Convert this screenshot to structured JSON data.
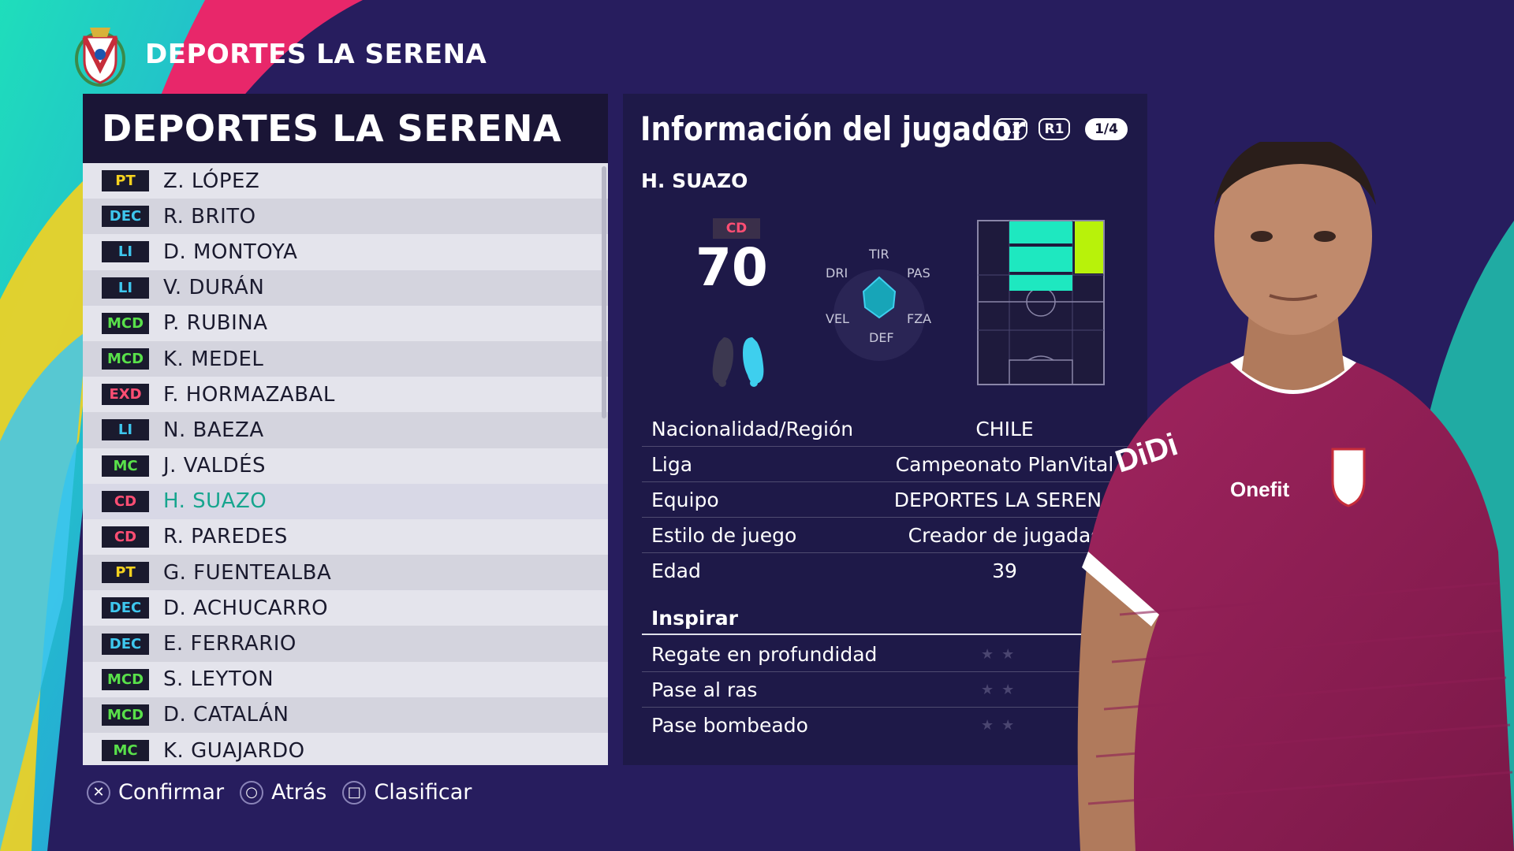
{
  "colors": {
    "background": "#271d5e",
    "selected_text": "#17a58e",
    "gk": "#f5d21f",
    "def": "#3ec7ee",
    "mid": "#59e04a",
    "fwd": "#ff4e73",
    "pitch_highlight": "#1ee8c0",
    "pitch_primary": "#b8f20a"
  },
  "header": {
    "title": "DEPORTES LA SERENA",
    "crest_icon": "club-crest-icon"
  },
  "roster": {
    "title": "DEPORTES LA SERENA",
    "players": [
      {
        "pos": "PT",
        "group": "gk",
        "name": "Z. LÓPEZ"
      },
      {
        "pos": "DEC",
        "group": "def",
        "name": "R. BRITO"
      },
      {
        "pos": "LI",
        "group": "def",
        "name": "D. MONTOYA"
      },
      {
        "pos": "LI",
        "group": "def",
        "name": "V. DURÁN"
      },
      {
        "pos": "MCD",
        "group": "mid",
        "name": "P. RUBINA"
      },
      {
        "pos": "MCD",
        "group": "mid",
        "name": "K. MEDEL"
      },
      {
        "pos": "EXD",
        "group": "fwd",
        "name": "F. HORMAZABAL"
      },
      {
        "pos": "LI",
        "group": "def",
        "name": "N. BAEZA"
      },
      {
        "pos": "MC",
        "group": "mid",
        "name": "J. VALDÉS"
      },
      {
        "pos": "CD",
        "group": "fwd",
        "name": "H. SUAZO",
        "selected": true
      },
      {
        "pos": "CD",
        "group": "fwd",
        "name": "R. PAREDES"
      },
      {
        "pos": "PT",
        "group": "gk",
        "name": "G. FUENTEALBA"
      },
      {
        "pos": "DEC",
        "group": "def",
        "name": "D. ACHUCARRO"
      },
      {
        "pos": "DEC",
        "group": "def",
        "name": "E. FERRARIO"
      },
      {
        "pos": "MCD",
        "group": "mid",
        "name": "S. LEYTON"
      },
      {
        "pos": "MCD",
        "group": "mid",
        "name": "D. CATALÁN"
      },
      {
        "pos": "MC",
        "group": "mid",
        "name": "K. GUAJARDO"
      }
    ]
  },
  "info": {
    "title": "Información del jugador",
    "chip_l1": "L1",
    "chip_r1": "R1",
    "page": "1/4",
    "player_name": "H. SUAZO",
    "position": "CD",
    "rating": "70",
    "radar_labels": {
      "tir": "TIR",
      "pas": "PAS",
      "fza": "FZA",
      "def": "DEF",
      "vel": "VEL",
      "dri": "DRI"
    },
    "details": [
      {
        "label": "Nacionalidad/Región",
        "value": "CHILE"
      },
      {
        "label": "Liga",
        "value": "Campeonato PlanVital"
      },
      {
        "label": "Equipo",
        "value": "DEPORTES LA SERENA"
      },
      {
        "label": "Estilo de juego",
        "value": "Creador de jugadas"
      },
      {
        "label": "Edad",
        "value": "39"
      }
    ],
    "inspire_heading": "Inspirar",
    "inspire": [
      {
        "label": "Regate en profundidad",
        "stars": 2
      },
      {
        "label": "Pase al ras",
        "stars": 2
      },
      {
        "label": "Pase bombeado",
        "stars": 2
      }
    ]
  },
  "hints": [
    {
      "icon": "cross-button-icon",
      "glyph": "✕",
      "label": "Confirmar"
    },
    {
      "icon": "circle-button-icon",
      "glyph": "○",
      "label": "Atrás"
    },
    {
      "icon": "square-button-icon",
      "glyph": "□",
      "label": "Clasificar"
    }
  ]
}
